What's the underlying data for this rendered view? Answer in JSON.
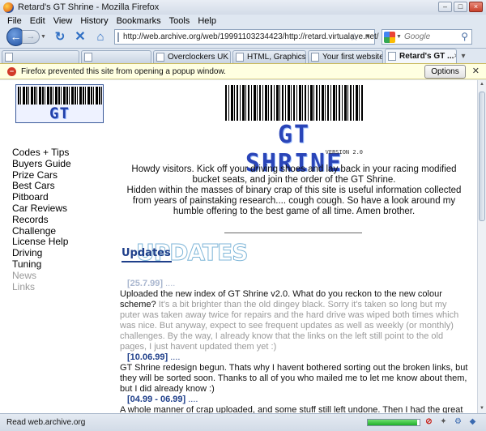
{
  "window": {
    "title": "Retard's GT Shrine - Mozilla Firefox",
    "controls": {
      "minimize": "–",
      "maximize": "□",
      "close": "×"
    }
  },
  "menu": [
    "File",
    "Edit",
    "View",
    "History",
    "Bookmarks",
    "Tools",
    "Help"
  ],
  "nav": {
    "url": "http://web.archive.org/web/19991103234423/http://retard.virtualave.net/",
    "search_placeholder": "Google"
  },
  "tabs": [
    {
      "label": "",
      "active": false
    },
    {
      "label": "",
      "active": false
    },
    {
      "label": "Overclockers UK ...",
      "active": false
    },
    {
      "label": "HTML, Graphics ...",
      "active": false
    },
    {
      "label": "Your first website ...",
      "active": false
    },
    {
      "label": "Retard's GT ...",
      "active": true
    }
  ],
  "notification": {
    "text": "Firefox prevented this site from opening a popup window.",
    "options_label": "Options"
  },
  "page": {
    "logo_small_text": "GT SHRINE",
    "logo_big_text": "GT SHRINE",
    "logo_version": "VERSION 2.0",
    "nav_links": [
      {
        "label": "Codes + Tips",
        "dim": false
      },
      {
        "label": "Buyers Guide",
        "dim": false
      },
      {
        "label": "Prize Cars",
        "dim": false
      },
      {
        "label": "Best Cars",
        "dim": false
      },
      {
        "label": "Pitboard",
        "dim": false
      },
      {
        "label": "Car Reviews",
        "dim": false
      },
      {
        "label": "Records",
        "dim": false
      },
      {
        "label": "Challenge",
        "dim": false
      },
      {
        "label": "License Help",
        "dim": false
      },
      {
        "label": "Driving",
        "dim": false
      },
      {
        "label": "Tuning",
        "dim": false
      },
      {
        "label": "News",
        "dim": true
      },
      {
        "label": "Links",
        "dim": true
      }
    ],
    "intro_1": "Howdy visitors. Kick off your driving shoes and lay back in your racing modified bucket seats, and join the order of the GT Shrine.",
    "intro_2": "Hidden within the masses of binary crap of this site is useful information collected from years of painstaking research.... cough cough. So have a look around my humble offering to the best game of all time. Amen brother.",
    "updates_outline": "UPDATES",
    "updates_label": "Updates",
    "entries": [
      {
        "date": "[25.7.99]",
        "dots": " ....",
        "text_dark": "Uploaded the new index of GT Shrine v2.0. What do you reckon to the new colour scheme?",
        "text_faded": "It's a bit brighter than the old dingey black. Sorry it's taken so long but my puter was taken away twice for repairs and the hard drive was wiped both times which was nice. But anyway, expect to see frequent updates as well as weekly (or monthly) challenges. By the way, I already know that the links on the left still point to the old pages, I just havent updated them yet :)",
        "faded_date": true
      },
      {
        "date": "[10.06.99]",
        "dots": " ....",
        "text_dark": "GT Shrine redesign begun. Thats why I havent bothered sorting out the broken links, but they will be sorted soon. Thanks to all of you who mailed me to let me know about them, but I did already know :)",
        "text_faded": "",
        "faded_date": false
      },
      {
        "date": "[04.99 - 06.99]",
        "dots": " ....",
        "text_dark": "A whole manner of crap uploaded, and some stuff still left undone. Then I had the great idea",
        "text_faded": "",
        "faded_date": false
      }
    ]
  },
  "status": {
    "text": "Read web.archive.org",
    "progress_fraction": 0.95
  }
}
